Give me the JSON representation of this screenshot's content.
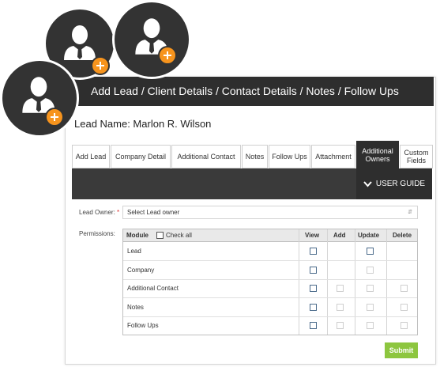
{
  "title": "Add Lead / Client Details / Contact Details / Notes / Follow Ups",
  "lead_name": "Lead Name: Marlon R. Wilson",
  "tabs": [
    {
      "label": "Add Lead"
    },
    {
      "label": "Company Detail"
    },
    {
      "label": "Additional Contact"
    },
    {
      "label": "Notes"
    },
    {
      "label": "Follow Ups"
    },
    {
      "label": "Attachment"
    },
    {
      "label": "Additional Owners",
      "active": true
    },
    {
      "label": "Custom Fields"
    }
  ],
  "user_guide": "USER GUIDE",
  "form": {
    "lead_owner_label": "Lead Owner:",
    "required_mark": "*",
    "lead_owner_value": "Select Lead owner",
    "permissions_label": "Permissions:"
  },
  "permissions": {
    "headers": {
      "module": "Module",
      "check_all": "Check all",
      "view": "View",
      "add": "Add",
      "update": "Update",
      "delete": "Delete"
    },
    "rows": [
      {
        "module": "Lead",
        "view": "enabled",
        "add": "none",
        "update": "enabled",
        "delete": "none"
      },
      {
        "module": "Company",
        "view": "enabled",
        "add": "none",
        "update": "disabled",
        "delete": "none"
      },
      {
        "module": "Additional Contact",
        "view": "enabled",
        "add": "disabled",
        "update": "disabled",
        "delete": "disabled"
      },
      {
        "module": "Notes",
        "view": "enabled",
        "add": "disabled",
        "update": "disabled",
        "delete": "disabled"
      },
      {
        "module": "Follow Ups",
        "view": "enabled",
        "add": "disabled",
        "update": "disabled",
        "delete": "disabled"
      }
    ]
  },
  "submit_label": "Submit",
  "colors": {
    "dark": "#2e2e2e",
    "accent_orange": "#f7941d",
    "submit_green": "#8dc63f"
  },
  "icons": [
    "user-add-icon",
    "chevron-down-icon"
  ]
}
